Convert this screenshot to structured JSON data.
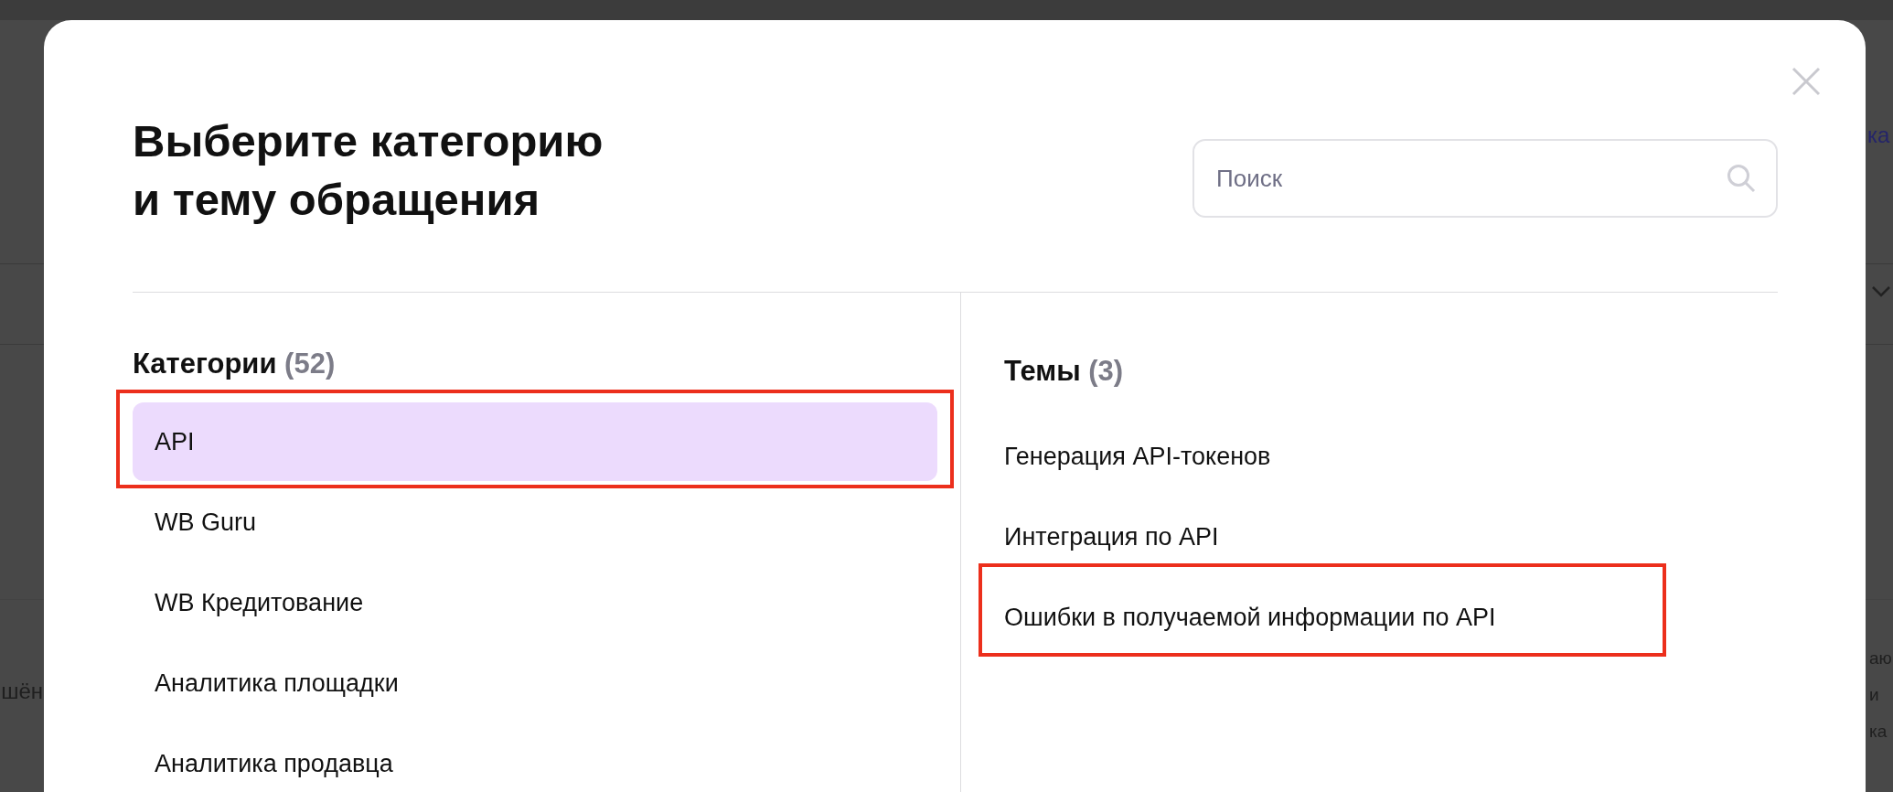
{
  "background": {
    "link_fragment": "ка",
    "left_fragment": "шён",
    "right_fragments": [
      "аю",
      "и",
      "ка"
    ]
  },
  "modal": {
    "title": "Выберите категорию\nи тему обращения",
    "search": {
      "placeholder": "Поиск"
    },
    "categories": {
      "heading": "Категории",
      "count": "(52)",
      "items": [
        {
          "label": "API",
          "selected": true,
          "annotated": true
        },
        {
          "label": "WB Guru",
          "selected": false,
          "annotated": false
        },
        {
          "label": "WB Кредитование",
          "selected": false,
          "annotated": false
        },
        {
          "label": "Аналитика площадки",
          "selected": false,
          "annotated": false
        },
        {
          "label": "Аналитика продавца",
          "selected": false,
          "annotated": false
        }
      ]
    },
    "topics": {
      "heading": "Темы",
      "count": "(3)",
      "items": [
        {
          "label": "Генерация API-токенов",
          "annotated": false
        },
        {
          "label": "Интеграция по API",
          "annotated": false
        },
        {
          "label": "Ошибки в получаемой информации по API",
          "annotated": true
        }
      ]
    }
  }
}
